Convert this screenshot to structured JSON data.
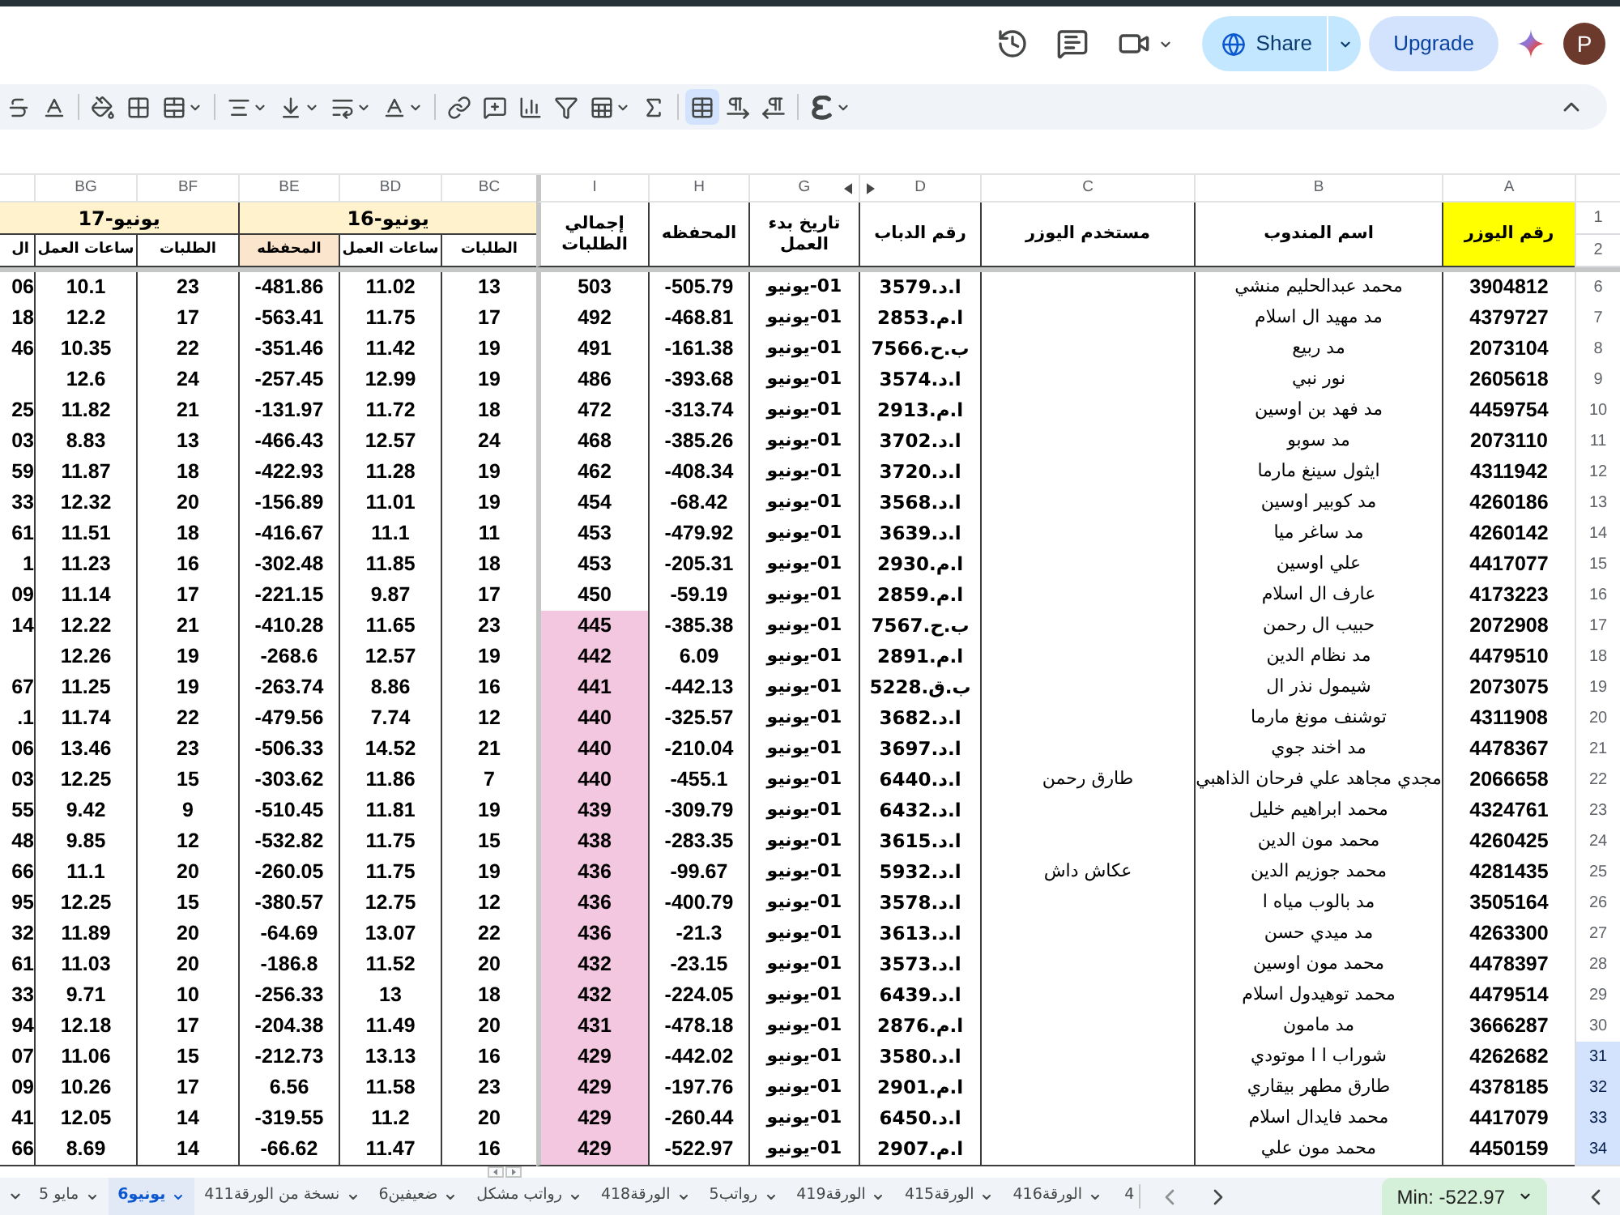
{
  "top_bar": {
    "share_label": "Share",
    "upgrade_label": "Upgrade",
    "avatar_initial": "P"
  },
  "toolbar": {
    "groups": [
      [
        {
          "kind": "strikethrough",
          "menu": false,
          "selected": false
        },
        {
          "kind": "text_color",
          "menu": false,
          "selected": false
        }
      ],
      [
        {
          "kind": "fill_color",
          "menu": false,
          "selected": false
        },
        {
          "kind": "borders",
          "menu": false,
          "selected": false
        },
        {
          "kind": "merge",
          "menu": true,
          "selected": false
        }
      ],
      [
        {
          "kind": "align",
          "menu": true,
          "selected": false
        },
        {
          "kind": "valign",
          "menu": true,
          "selected": false
        },
        {
          "kind": "wrap",
          "menu": true,
          "selected": false
        },
        {
          "kind": "rotate",
          "menu": true,
          "selected": false
        }
      ],
      [
        {
          "kind": "link",
          "menu": false,
          "selected": false
        },
        {
          "kind": "comment",
          "menu": false,
          "selected": false
        },
        {
          "kind": "chart",
          "menu": false,
          "selected": false
        },
        {
          "kind": "filter",
          "menu": false,
          "selected": false
        },
        {
          "kind": "views",
          "menu": true,
          "selected": false
        },
        {
          "kind": "functions",
          "menu": false,
          "selected": false
        }
      ],
      [
        {
          "kind": "sheet_rtl",
          "menu": false,
          "selected": true
        },
        {
          "kind": "ltr",
          "menu": false,
          "selected": false
        },
        {
          "kind": "rtl",
          "menu": false,
          "selected": false
        }
      ],
      [
        {
          "kind": "input_tools",
          "menu": true,
          "selected": false
        }
      ]
    ]
  },
  "sheet": {
    "column_letters": [
      "A",
      "B",
      "C",
      "D",
      "G",
      "H",
      "I",
      "BC",
      "BD",
      "BE",
      "BF",
      "BG"
    ],
    "header_row_numbers": [
      "1",
      "2"
    ],
    "headers": [
      {
        "label": "رقم اليوزر",
        "color": "#ffff00"
      },
      {
        "label": "اسم المندوب"
      },
      {
        "label": "مستخدم اليوزر"
      },
      {
        "label": "رقم الدباب"
      },
      {
        "label": "تاريخ بدء العمل"
      },
      {
        "label": "المحفظه"
      },
      {
        "label": "إجمالي الطلبات"
      }
    ],
    "date_groups": [
      {
        "label": "يونيو-16",
        "color": "#fff2cc",
        "subheaders": [
          {
            "label": "الطلبات"
          },
          {
            "label": "ساعات العمل"
          },
          {
            "label": "المحفظه",
            "color": "#fce5cd"
          }
        ]
      },
      {
        "label": "يونيو-17",
        "color": "#fff2cc",
        "subheaders": [
          {
            "label": "الطلبات"
          },
          {
            "label": "ساعات العمل"
          },
          {
            "label": "ال"
          }
        ]
      }
    ],
    "rows": [
      {
        "row": "6",
        "selected": false,
        "a": "3904812",
        "b": "محمد عبدالحليم منشي",
        "d": "ا.د.3579",
        "g": "01-يونيو",
        "h": "-505.79",
        "i": "503",
        "i_highlighted": false,
        "bc": "13",
        "bd": "11.02",
        "be": "-481.86",
        "bf": "23",
        "bg": "10.1",
        "cut_column": "06"
      },
      {
        "row": "7",
        "selected": false,
        "a": "4379727",
        "b": "مد مهيد ال اسلام",
        "d": "ا.م.2853",
        "g": "01-يونيو",
        "h": "-468.81",
        "i": "492",
        "i_highlighted": false,
        "bc": "17",
        "bd": "11.75",
        "be": "-563.41",
        "bf": "17",
        "bg": "12.2",
        "cut_column": "18"
      },
      {
        "row": "8",
        "selected": false,
        "a": "2073104",
        "b": "مد ربيع",
        "d": "ب.ح.7566",
        "g": "01-يونيو",
        "h": "-161.38",
        "i": "491",
        "i_highlighted": false,
        "bc": "19",
        "bd": "11.42",
        "be": "-351.46",
        "bf": "22",
        "bg": "10.35",
        "cut_column": "46"
      },
      {
        "row": "9",
        "selected": false,
        "a": "2605618",
        "b": "نور نبي",
        "d": "ا.د.3574",
        "g": "01-يونيو",
        "h": "-393.68",
        "i": "486",
        "i_highlighted": false,
        "bc": "19",
        "bd": "12.99",
        "be": "-257.45",
        "bf": "24",
        "bg": "12.6"
      },
      {
        "row": "10",
        "selected": false,
        "a": "4459754",
        "b": "مد فهد بن اوسين",
        "d": "ا.م.2913",
        "g": "01-يونيو",
        "h": "-313.74",
        "i": "472",
        "i_highlighted": false,
        "bc": "18",
        "bd": "11.72",
        "be": "-131.97",
        "bf": "21",
        "bg": "11.82",
        "cut_column": "25"
      },
      {
        "row": "11",
        "selected": false,
        "a": "2073110",
        "b": "مد سوبو",
        "d": "ا.د.3702",
        "g": "01-يونيو",
        "h": "-385.26",
        "i": "468",
        "i_highlighted": false,
        "bc": "24",
        "bd": "12.57",
        "be": "-466.43",
        "bf": "13",
        "bg": "8.83",
        "cut_column": "03"
      },
      {
        "row": "12",
        "selected": false,
        "a": "4311942",
        "b": "ايثول سينغ مارما",
        "d": "ا.د.3720",
        "g": "01-يونيو",
        "h": "-408.34",
        "i": "462",
        "i_highlighted": false,
        "bc": "19",
        "bd": "11.28",
        "be": "-422.93",
        "bf": "18",
        "bg": "11.87",
        "cut_column": "59"
      },
      {
        "row": "13",
        "selected": false,
        "a": "4260186",
        "b": "مد كوبير اوسين",
        "d": "ا.د.3568",
        "g": "01-يونيو",
        "h": "-68.42",
        "i": "454",
        "i_highlighted": false,
        "bc": "19",
        "bd": "11.01",
        "be": "-156.89",
        "bf": "20",
        "bg": "12.32",
        "cut_column": "33"
      },
      {
        "row": "14",
        "selected": false,
        "a": "4260142",
        "b": "مد ساغر ميا",
        "d": "ا.د.3639",
        "g": "01-يونيو",
        "h": "-479.92",
        "i": "453",
        "i_highlighted": false,
        "bc": "11",
        "bd": "11.1",
        "be": "-416.67",
        "bf": "18",
        "bg": "11.51",
        "cut_column": "61"
      },
      {
        "row": "15",
        "selected": false,
        "a": "4417077",
        "b": "علي اوسين",
        "d": "ا.م.2930",
        "g": "01-يونيو",
        "h": "-205.31",
        "i": "453",
        "i_highlighted": false,
        "bc": "18",
        "bd": "11.85",
        "be": "-302.48",
        "bf": "16",
        "bg": "11.23",
        "cut_column": "1"
      },
      {
        "row": "16",
        "selected": false,
        "a": "4173223",
        "b": "عارف ال اسلام",
        "d": "ا.م.2859",
        "g": "01-يونيو",
        "h": "-59.19",
        "i": "450",
        "i_highlighted": false,
        "bc": "17",
        "bd": "9.87",
        "be": "-221.15",
        "bf": "17",
        "bg": "11.14",
        "cut_column": "09"
      },
      {
        "row": "17",
        "selected": false,
        "a": "2072908",
        "b": "حبيب ال رحمن",
        "d": "ب.ح.7567",
        "g": "01-يونيو",
        "h": "-385.38",
        "i": "445",
        "i_highlighted": true,
        "bc": "23",
        "bd": "11.65",
        "be": "-410.28",
        "bf": "21",
        "bg": "12.22",
        "cut_column": "14"
      },
      {
        "row": "18",
        "selected": false,
        "a": "4479510",
        "b": "مد نظام الدين",
        "d": "ا.م.2891",
        "g": "01-يونيو",
        "h": "6.09",
        "i": "442",
        "i_highlighted": true,
        "bc": "19",
        "bd": "12.57",
        "be": "-268.6",
        "bf": "19",
        "bg": "12.26"
      },
      {
        "row": "19",
        "selected": false,
        "a": "2073075",
        "b": "شيمول نذر ال",
        "d": "ب.ق.5228",
        "g": "01-يونيو",
        "h": "-442.13",
        "i": "441",
        "i_highlighted": true,
        "bc": "16",
        "bd": "8.86",
        "be": "-263.74",
        "bf": "19",
        "bg": "11.25",
        "cut_column": "67"
      },
      {
        "row": "20",
        "selected": false,
        "a": "4311908",
        "b": "توشنف مونغ مارما",
        "d": "ا.د.3682",
        "g": "01-يونيو",
        "h": "-325.57",
        "i": "440",
        "i_highlighted": true,
        "bc": "12",
        "bd": "7.74",
        "be": "-479.56",
        "bf": "22",
        "bg": "11.74",
        "cut_column": ".1"
      },
      {
        "row": "21",
        "selected": false,
        "a": "4478367",
        "b": "مد اخند جوي",
        "d": "ا.د.3697",
        "g": "01-يونيو",
        "h": "-210.04",
        "i": "440",
        "i_highlighted": true,
        "bc": "21",
        "bd": "14.52",
        "be": "-506.33",
        "bf": "23",
        "bg": "13.46",
        "cut_column": "06"
      },
      {
        "row": "22",
        "selected": false,
        "a": "2066658",
        "b": "مجدي مجاهد علي فرحان الذاهبي",
        "c": "طارق رحمن",
        "d": "ا.د.6440",
        "g": "01-يونيو",
        "h": "-455.1",
        "i": "440",
        "i_highlighted": true,
        "bc": "7",
        "bd": "11.86",
        "be": "-303.62",
        "bf": "15",
        "bg": "12.25",
        "cut_column": "03"
      },
      {
        "row": "23",
        "selected": false,
        "a": "4324761",
        "b": "محمد ابراهيم خليل",
        "d": "ا.د.6432",
        "g": "01-يونيو",
        "h": "-309.79",
        "i": "439",
        "i_highlighted": true,
        "bc": "19",
        "bd": "11.81",
        "be": "-510.45",
        "bf": "9",
        "bg": "9.42",
        "cut_column": "55"
      },
      {
        "row": "24",
        "selected": false,
        "a": "4260425",
        "b": "محمد مون الدين",
        "d": "ا.د.3615",
        "g": "01-يونيو",
        "h": "-283.35",
        "i": "438",
        "i_highlighted": true,
        "bc": "15",
        "bd": "11.75",
        "be": "-532.82",
        "bf": "12",
        "bg": "9.85",
        "cut_column": "48"
      },
      {
        "row": "25",
        "selected": false,
        "a": "4281435",
        "b": "محمد جوزيم الدين",
        "c": "عكاش داش",
        "d": "ا.د.5932",
        "g": "01-يونيو",
        "h": "-99.67",
        "i": "436",
        "i_highlighted": true,
        "bc": "19",
        "bd": "11.75",
        "be": "-260.05",
        "bf": "20",
        "bg": "11.1",
        "cut_column": "66"
      },
      {
        "row": "26",
        "selected": false,
        "a": "3505164",
        "b": "مد بالوب مياه ا",
        "d": "ا.د.3578",
        "g": "01-يونيو",
        "h": "-400.79",
        "i": "436",
        "i_highlighted": true,
        "bc": "12",
        "bd": "12.75",
        "be": "-380.57",
        "bf": "15",
        "bg": "12.25",
        "cut_column": "95"
      },
      {
        "row": "27",
        "selected": false,
        "a": "4263300",
        "b": "مد ميدي حسن",
        "d": "ا.د.3613",
        "g": "01-يونيو",
        "h": "-21.3",
        "i": "436",
        "i_highlighted": true,
        "bc": "22",
        "bd": "13.07",
        "be": "-64.69",
        "bf": "20",
        "bg": "11.89",
        "cut_column": "32"
      },
      {
        "row": "28",
        "selected": false,
        "a": "4478397",
        "b": "محمد مون اوسين",
        "d": "ا.د.3573",
        "g": "01-يونيو",
        "h": "-23.15",
        "i": "432",
        "i_highlighted": true,
        "bc": "20",
        "bd": "11.52",
        "be": "-186.8",
        "bf": "20",
        "bg": "11.03",
        "cut_column": "61"
      },
      {
        "row": "29",
        "selected": false,
        "a": "4479514",
        "b": "محمد توهيدول اسلام",
        "d": "ا.د.6439",
        "g": "01-يونيو",
        "h": "-224.05",
        "i": "432",
        "i_highlighted": true,
        "bc": "18",
        "bd": "13",
        "be": "-256.33",
        "bf": "10",
        "bg": "9.71",
        "cut_column": "33"
      },
      {
        "row": "30",
        "selected": false,
        "a": "3666287",
        "b": "مد مامون",
        "d": "ا.م.2876",
        "g": "01-يونيو",
        "h": "-478.18",
        "i": "431",
        "i_highlighted": true,
        "bc": "20",
        "bd": "11.49",
        "be": "-204.38",
        "bf": "17",
        "bg": "12.18",
        "cut_column": "94"
      },
      {
        "row": "31",
        "selected": true,
        "a": "4262682",
        "b": "شوراب ا ا موتودي",
        "d": "ا.د.3580",
        "g": "01-يونيو",
        "h": "-442.02",
        "i": "429",
        "i_highlighted": true,
        "bc": "16",
        "bd": "13.13",
        "be": "-212.73",
        "bf": "15",
        "bg": "11.06",
        "cut_column": "07"
      },
      {
        "row": "32",
        "selected": true,
        "a": "4378185",
        "b": "طارق مطهر بيقاري",
        "d": "ا.م.2901",
        "g": "01-يونيو",
        "h": "-197.76",
        "i": "429",
        "i_highlighted": true,
        "bc": "23",
        "bd": "11.58",
        "be": "6.56",
        "bf": "17",
        "bg": "10.26",
        "cut_column": "09"
      },
      {
        "row": "33",
        "selected": true,
        "a": "4417079",
        "b": "محمد فايدال اسلام",
        "d": "ا.د.6450",
        "g": "01-يونيو",
        "h": "-260.44",
        "i": "429",
        "i_highlighted": true,
        "bc": "20",
        "bd": "11.2",
        "be": "-319.55",
        "bf": "14",
        "bg": "12.05",
        "cut_column": "41"
      },
      {
        "row": "34",
        "selected": true,
        "a": "4450159",
        "b": "محمد مون علي",
        "d": "ا.م.2907",
        "g": "01-يونيو",
        "h": "-522.97",
        "i": "429",
        "i_highlighted": true,
        "bc": "16",
        "bd": "11.47",
        "be": "-66.62",
        "bf": "14",
        "bg": "8.69",
        "cut_column": "66"
      }
    ]
  },
  "sheet_tabs": [
    {
      "label": "4",
      "selected": false,
      "cut": true
    },
    {
      "label": "الورقة416",
      "selected": false,
      "cut": false
    },
    {
      "label": "الورقة415",
      "selected": false,
      "cut": false
    },
    {
      "label": "الورقة419",
      "selected": false,
      "cut": false
    },
    {
      "label": "رواتب5",
      "selected": false,
      "cut": false
    },
    {
      "label": "الورقة418",
      "selected": false,
      "cut": false
    },
    {
      "label": "رواتب مشكل",
      "selected": false,
      "cut": false
    },
    {
      "label": "ضعيفين6",
      "selected": false,
      "cut": false
    },
    {
      "label": "نسخة من الورقة411",
      "selected": false,
      "cut": false
    },
    {
      "label": "يونيو6",
      "selected": true,
      "cut": false
    },
    {
      "label": "مايو 5",
      "selected": false,
      "cut": false
    }
  ],
  "status": {
    "summary": "Min: -522.97"
  }
}
